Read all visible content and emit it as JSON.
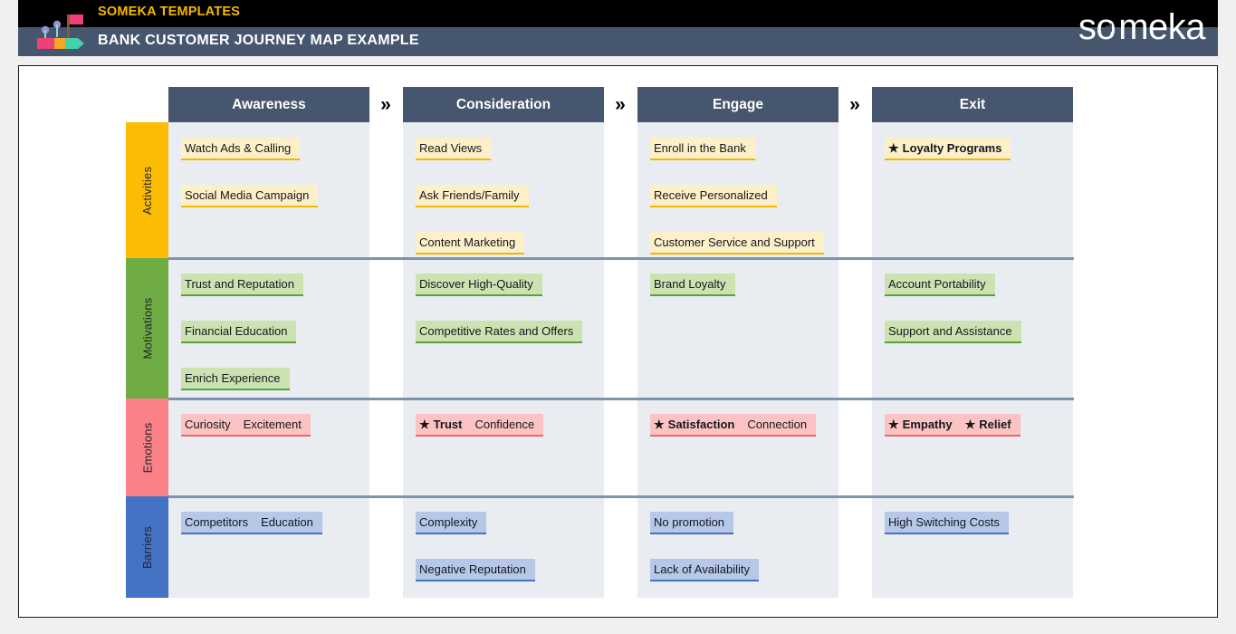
{
  "header": {
    "brand": "SOMEKA TEMPLATES",
    "title": "BANK CUSTOMER JOURNEY MAP EXAMPLE",
    "logo_word_start": "s",
    "logo_word_end": "meka",
    "brand_color": "#f5b800",
    "bar_color": "#46566e"
  },
  "stages": [
    {
      "label": "Awareness"
    },
    {
      "label": "Consideration"
    },
    {
      "label": "Engage"
    },
    {
      "label": "Exit"
    }
  ],
  "chevron": "»",
  "rows": [
    {
      "label": "Activities",
      "color": "#fcbc04",
      "columns": [
        [
          {
            "text": "Watch Ads & Calling",
            "starred": false
          },
          {
            "text": "Social Media Campaign",
            "starred": false
          }
        ],
        [
          {
            "text": "Read Views",
            "starred": false
          },
          {
            "text": "Ask Friends/Family",
            "starred": false
          },
          {
            "text": "Content Marketing",
            "starred": false
          }
        ],
        [
          {
            "text": "Enroll in the Bank",
            "starred": false
          },
          {
            "text": "Receive Personalized",
            "starred": false
          },
          {
            "text": "Customer Service and Support",
            "starred": false
          }
        ],
        [
          {
            "text": "Loyalty Programs",
            "starred": true
          }
        ]
      ]
    },
    {
      "label": "Motivations",
      "color": "#6fac44",
      "columns": [
        [
          {
            "text": "Trust and Reputation",
            "starred": false
          },
          {
            "text": "Financial Education",
            "starred": false
          },
          {
            "text": "Enrich Experience",
            "starred": false
          }
        ],
        [
          {
            "text": "Discover High-Quality",
            "starred": false
          },
          {
            "text": "Competitive Rates and Offers",
            "starred": false
          }
        ],
        [
          {
            "text": "Brand Loyalty",
            "starred": false
          }
        ],
        [
          {
            "text": "Account Portability",
            "starred": false
          },
          {
            "text": "Support and Assistance",
            "starred": false
          }
        ]
      ]
    },
    {
      "label": "Emotions",
      "color": "#fb8188",
      "columns": [
        [
          {
            "text": "Curiosity",
            "starred": false
          },
          {
            "text": "Excitement",
            "starred": false
          }
        ],
        [
          {
            "text": "Trust",
            "starred": true
          },
          {
            "text": "Confidence",
            "starred": false
          }
        ],
        [
          {
            "text": "Satisfaction",
            "starred": true
          },
          {
            "text": "Connection",
            "starred": false
          }
        ],
        [
          {
            "text": "Empathy",
            "starred": true
          },
          {
            "text": "Relief",
            "starred": true
          }
        ]
      ]
    },
    {
      "label": "Barriers",
      "color": "#4472c4",
      "columns": [
        [
          {
            "text": "Competitors",
            "starred": false
          },
          {
            "text": "Education",
            "starred": false
          }
        ],
        [
          {
            "text": "Complexity",
            "starred": false
          },
          {
            "text": "Negative Reputation",
            "starred": false
          }
        ],
        [
          {
            "text": "No promotion",
            "starred": false
          },
          {
            "text": "Lack of Availability",
            "starred": false
          }
        ],
        [
          {
            "text": "High Switching Costs",
            "starred": false
          }
        ]
      ]
    }
  ],
  "star_glyph": "★"
}
